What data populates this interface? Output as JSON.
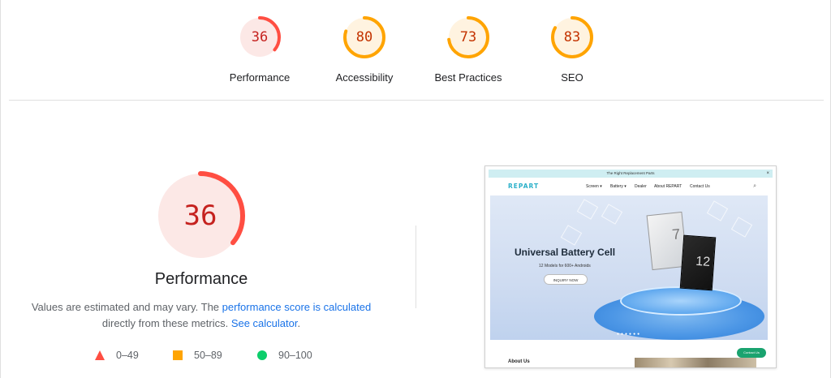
{
  "colors": {
    "fail": "#ff4e42",
    "average": "#ffa400",
    "pass": "#0cce6b",
    "fail_text": "#c5221f",
    "average_text": "#c33300",
    "link": "#1a73e8"
  },
  "gauges": [
    {
      "score": "36",
      "label": "Performance",
      "percent": 36,
      "rating": "fail"
    },
    {
      "score": "80",
      "label": "Accessibility",
      "percent": 80,
      "rating": "average"
    },
    {
      "score": "73",
      "label": "Best Practices",
      "percent": 73,
      "rating": "average"
    },
    {
      "score": "83",
      "label": "SEO",
      "percent": 83,
      "rating": "average"
    }
  ],
  "main": {
    "score": "36",
    "percent": 36,
    "title": "Performance",
    "desc_part1": "Values are estimated and may vary. The ",
    "desc_link1": "performance score is calculated",
    "desc_part2": "directly from these metrics. ",
    "desc_link2": "See calculator",
    "desc_end": "."
  },
  "legend": [
    {
      "icon": "triangle-icon",
      "text": "0–49"
    },
    {
      "icon": "square-icon",
      "text": "50–89"
    },
    {
      "icon": "circle-icon",
      "text": "90–100"
    }
  ],
  "thumbnail": {
    "promo": "The Right Replacement Parts",
    "close": "×",
    "logo": "REPART",
    "nav": [
      "Screen ▾",
      "Battery ▾",
      "Dealer",
      "About REPART",
      "Contact Us"
    ],
    "search": "⌕",
    "hero_title": "Universal Battery Cell",
    "hero_sub": "12 Models for 600+ Androids",
    "hero_button": "INQUIRY NOW",
    "cell1_num": "7",
    "cell2_num": "12",
    "dots": "●●●●●●",
    "about": "About Us",
    "chat": "Contact Us"
  }
}
